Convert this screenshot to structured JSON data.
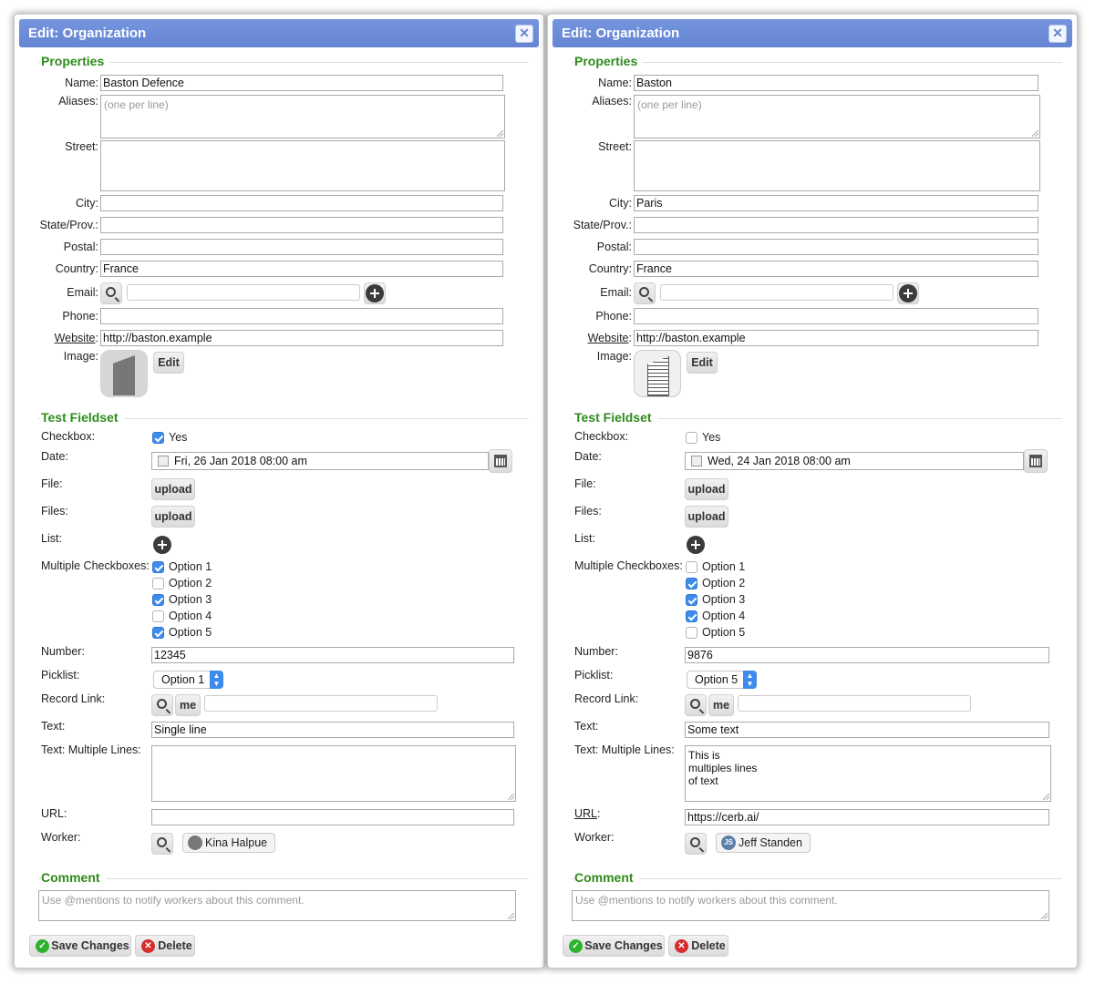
{
  "dialogs": [
    {
      "title": "Edit: Organization",
      "close_glyph": "✕",
      "properties_legend": "Properties",
      "labels": {
        "name": "Name:",
        "aliases": "Aliases:",
        "street": "Street:",
        "city": "City:",
        "state": "State/Prov.:",
        "postal": "Postal:",
        "country": "Country:",
        "email": "Email:",
        "phone": "Phone:",
        "website": "Website",
        "website_colon": ":",
        "image": "Image:"
      },
      "values": {
        "name": "Baston Defence",
        "aliases_placeholder": "(one per line)",
        "street": "",
        "city": "",
        "state": "",
        "postal": "",
        "country": "France",
        "email": "",
        "phone": "",
        "website": "http://baston.example"
      },
      "image_edit_label": "Edit",
      "test_legend": "Test Fieldset",
      "fields": {
        "checkbox_label": "Checkbox:",
        "checkbox_value": "Yes",
        "checkbox_checked": true,
        "date_label": "Date:",
        "date_value": "Fri, 26 Jan 2018 08:00 am",
        "file_label": "File:",
        "files_label": "Files:",
        "upload_label": "upload",
        "list_label": "List:",
        "multi_label": "Multiple Checkboxes:",
        "options": [
          {
            "label": "Option 1",
            "checked": true
          },
          {
            "label": "Option 2",
            "checked": false
          },
          {
            "label": "Option 3",
            "checked": true
          },
          {
            "label": "Option 4",
            "checked": false
          },
          {
            "label": "Option 5",
            "checked": true
          }
        ],
        "number_label": "Number:",
        "number_value": "12345",
        "picklist_label": "Picklist:",
        "picklist_value": "Option 1",
        "recordlink_label": "Record Link:",
        "me_label": "me",
        "text_label": "Text:",
        "text_value": "Single line",
        "textml_label": "Text: Multiple Lines:",
        "textml_value": "",
        "url_label": "URL:",
        "url_value": "",
        "worker_label": "Worker:",
        "worker_name": "Kina Halpue",
        "worker_initials": ""
      },
      "comment_legend": "Comment",
      "comment_placeholder": "Use @mentions to notify workers about this comment.",
      "save_label": "Save Changes",
      "delete_label": "Delete"
    },
    {
      "title": "Edit: Organization",
      "close_glyph": "✕",
      "properties_legend": "Properties",
      "labels": {
        "name": "Name:",
        "aliases": "Aliases:",
        "street": "Street:",
        "city": "City:",
        "state": "State/Prov.:",
        "postal": "Postal:",
        "country": "Country:",
        "email": "Email:",
        "phone": "Phone:",
        "website": "Website",
        "website_colon": ":",
        "image": "Image:"
      },
      "values": {
        "name": "Baston",
        "aliases_placeholder": "(one per line)",
        "street": "",
        "city": "Paris",
        "state": "",
        "postal": "",
        "country": "France",
        "email": "",
        "phone": "",
        "website": "http://baston.example"
      },
      "image_edit_label": "Edit",
      "test_legend": "Test Fieldset",
      "fields": {
        "checkbox_label": "Checkbox:",
        "checkbox_value": "Yes",
        "checkbox_checked": false,
        "date_label": "Date:",
        "date_value": "Wed, 24 Jan 2018 08:00 am",
        "file_label": "File:",
        "files_label": "Files:",
        "upload_label": "upload",
        "list_label": "List:",
        "multi_label": "Multiple Checkboxes:",
        "options": [
          {
            "label": "Option 1",
            "checked": false
          },
          {
            "label": "Option 2",
            "checked": true
          },
          {
            "label": "Option 3",
            "checked": true
          },
          {
            "label": "Option 4",
            "checked": true
          },
          {
            "label": "Option 5",
            "checked": false
          }
        ],
        "number_label": "Number:",
        "number_value": "9876",
        "picklist_label": "Picklist:",
        "picklist_value": "Option 5",
        "recordlink_label": "Record Link:",
        "me_label": "me",
        "text_label": "Text:",
        "text_value": "Some text",
        "textml_label": "Text: Multiple Lines:",
        "textml_value": "This is\nmultiples lines\nof text",
        "url_label": "URL",
        "url_label_colon": ":",
        "url_value": "https://cerb.ai/",
        "worker_label": "Worker:",
        "worker_name": "Jeff Standen",
        "worker_initials": "JS"
      },
      "comment_legend": "Comment",
      "comment_placeholder": "Use @mentions to notify workers about this comment.",
      "save_label": "Save Changes",
      "delete_label": "Delete"
    }
  ]
}
